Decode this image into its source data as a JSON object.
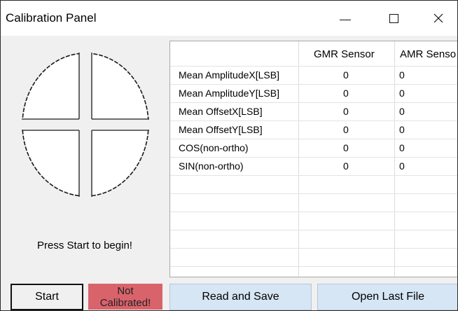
{
  "window": {
    "title": "Calibration Panel"
  },
  "status_text": "Press Start to begin!",
  "table": {
    "columns": [
      "",
      "GMR Sensor",
      "AMR Senso"
    ],
    "rows": [
      {
        "label": "Mean AmplitudeX[LSB]",
        "gmr": "0",
        "amr": "0"
      },
      {
        "label": "Mean AmplitudeY[LSB]",
        "gmr": "0",
        "amr": "0"
      },
      {
        "label": "Mean OffsetX[LSB]",
        "gmr": "0",
        "amr": "0"
      },
      {
        "label": "Mean OffsetY[LSB]",
        "gmr": "0",
        "amr": "0"
      },
      {
        "label": "COS(non-ortho)",
        "gmr": "0",
        "amr": "0"
      },
      {
        "label": "SIN(non-ortho)",
        "gmr": "0",
        "amr": "0"
      }
    ]
  },
  "buttons": {
    "start": "Start",
    "status_line1": "Not",
    "status_line2": "Calibrated!",
    "read_save": "Read and Save",
    "open_last": "Open Last File"
  },
  "colors": {
    "status_bg": "#d9636b",
    "action_bg": "#d6e6f4"
  },
  "icons": {
    "minimize": "minimize-icon",
    "maximize": "maximize-icon",
    "close": "close-icon"
  }
}
